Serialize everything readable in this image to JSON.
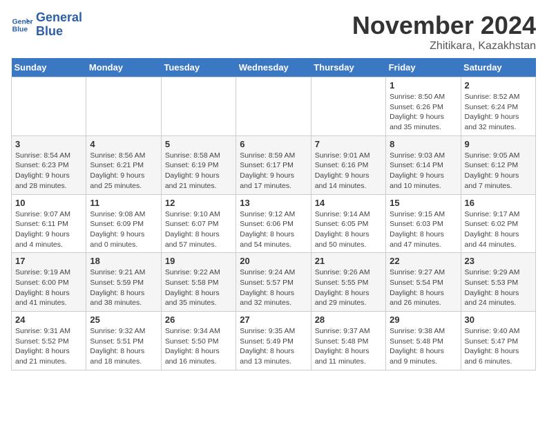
{
  "logo": {
    "line1": "General",
    "line2": "Blue"
  },
  "title": "November 2024",
  "location": "Zhitikara, Kazakhstan",
  "days_of_week": [
    "Sunday",
    "Monday",
    "Tuesday",
    "Wednesday",
    "Thursday",
    "Friday",
    "Saturday"
  ],
  "weeks": [
    [
      {
        "day": "",
        "info": ""
      },
      {
        "day": "",
        "info": ""
      },
      {
        "day": "",
        "info": ""
      },
      {
        "day": "",
        "info": ""
      },
      {
        "day": "",
        "info": ""
      },
      {
        "day": "1",
        "info": "Sunrise: 8:50 AM\nSunset: 6:26 PM\nDaylight: 9 hours and 35 minutes."
      },
      {
        "day": "2",
        "info": "Sunrise: 8:52 AM\nSunset: 6:24 PM\nDaylight: 9 hours and 32 minutes."
      }
    ],
    [
      {
        "day": "3",
        "info": "Sunrise: 8:54 AM\nSunset: 6:23 PM\nDaylight: 9 hours and 28 minutes."
      },
      {
        "day": "4",
        "info": "Sunrise: 8:56 AM\nSunset: 6:21 PM\nDaylight: 9 hours and 25 minutes."
      },
      {
        "day": "5",
        "info": "Sunrise: 8:58 AM\nSunset: 6:19 PM\nDaylight: 9 hours and 21 minutes."
      },
      {
        "day": "6",
        "info": "Sunrise: 8:59 AM\nSunset: 6:17 PM\nDaylight: 9 hours and 17 minutes."
      },
      {
        "day": "7",
        "info": "Sunrise: 9:01 AM\nSunset: 6:16 PM\nDaylight: 9 hours and 14 minutes."
      },
      {
        "day": "8",
        "info": "Sunrise: 9:03 AM\nSunset: 6:14 PM\nDaylight: 9 hours and 10 minutes."
      },
      {
        "day": "9",
        "info": "Sunrise: 9:05 AM\nSunset: 6:12 PM\nDaylight: 9 hours and 7 minutes."
      }
    ],
    [
      {
        "day": "10",
        "info": "Sunrise: 9:07 AM\nSunset: 6:11 PM\nDaylight: 9 hours and 4 minutes."
      },
      {
        "day": "11",
        "info": "Sunrise: 9:08 AM\nSunset: 6:09 PM\nDaylight: 9 hours and 0 minutes."
      },
      {
        "day": "12",
        "info": "Sunrise: 9:10 AM\nSunset: 6:07 PM\nDaylight: 8 hours and 57 minutes."
      },
      {
        "day": "13",
        "info": "Sunrise: 9:12 AM\nSunset: 6:06 PM\nDaylight: 8 hours and 54 minutes."
      },
      {
        "day": "14",
        "info": "Sunrise: 9:14 AM\nSunset: 6:05 PM\nDaylight: 8 hours and 50 minutes."
      },
      {
        "day": "15",
        "info": "Sunrise: 9:15 AM\nSunset: 6:03 PM\nDaylight: 8 hours and 47 minutes."
      },
      {
        "day": "16",
        "info": "Sunrise: 9:17 AM\nSunset: 6:02 PM\nDaylight: 8 hours and 44 minutes."
      }
    ],
    [
      {
        "day": "17",
        "info": "Sunrise: 9:19 AM\nSunset: 6:00 PM\nDaylight: 8 hours and 41 minutes."
      },
      {
        "day": "18",
        "info": "Sunrise: 9:21 AM\nSunset: 5:59 PM\nDaylight: 8 hours and 38 minutes."
      },
      {
        "day": "19",
        "info": "Sunrise: 9:22 AM\nSunset: 5:58 PM\nDaylight: 8 hours and 35 minutes."
      },
      {
        "day": "20",
        "info": "Sunrise: 9:24 AM\nSunset: 5:57 PM\nDaylight: 8 hours and 32 minutes."
      },
      {
        "day": "21",
        "info": "Sunrise: 9:26 AM\nSunset: 5:55 PM\nDaylight: 8 hours and 29 minutes."
      },
      {
        "day": "22",
        "info": "Sunrise: 9:27 AM\nSunset: 5:54 PM\nDaylight: 8 hours and 26 minutes."
      },
      {
        "day": "23",
        "info": "Sunrise: 9:29 AM\nSunset: 5:53 PM\nDaylight: 8 hours and 24 minutes."
      }
    ],
    [
      {
        "day": "24",
        "info": "Sunrise: 9:31 AM\nSunset: 5:52 PM\nDaylight: 8 hours and 21 minutes."
      },
      {
        "day": "25",
        "info": "Sunrise: 9:32 AM\nSunset: 5:51 PM\nDaylight: 8 hours and 18 minutes."
      },
      {
        "day": "26",
        "info": "Sunrise: 9:34 AM\nSunset: 5:50 PM\nDaylight: 8 hours and 16 minutes."
      },
      {
        "day": "27",
        "info": "Sunrise: 9:35 AM\nSunset: 5:49 PM\nDaylight: 8 hours and 13 minutes."
      },
      {
        "day": "28",
        "info": "Sunrise: 9:37 AM\nSunset: 5:48 PM\nDaylight: 8 hours and 11 minutes."
      },
      {
        "day": "29",
        "info": "Sunrise: 9:38 AM\nSunset: 5:48 PM\nDaylight: 8 hours and 9 minutes."
      },
      {
        "day": "30",
        "info": "Sunrise: 9:40 AM\nSunset: 5:47 PM\nDaylight: 8 hours and 6 minutes."
      }
    ]
  ]
}
